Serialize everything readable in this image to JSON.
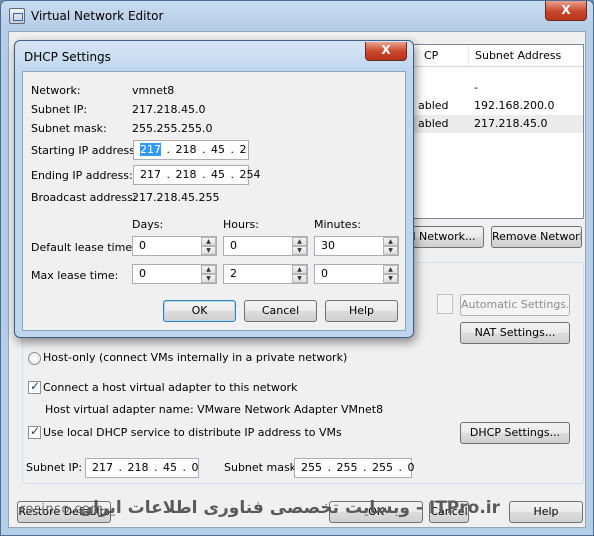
{
  "main": {
    "title": "Virtual Network Editor",
    "close_glyph": "X",
    "table": {
      "col_dhcp": "CP",
      "col_subnet": "Subnet Address",
      "rows": [
        {
          "dhcp": "",
          "subnet": "-"
        },
        {
          "dhcp": "abled",
          "subnet": "192.168.200.0"
        },
        {
          "dhcp": "abled",
          "subnet": "217.218.45.0"
        }
      ]
    },
    "add_network_label": "l Network...",
    "remove_network_label": "Remove Network",
    "automatic_settings_label": "Automatic Settings...",
    "nat_settings_label": "NAT Settings...",
    "host_only_label": "Host-only (connect VMs internally in a private network)",
    "connect_adapter_label": "Connect a host virtual adapter to this network",
    "adapter_name_text": "Host virtual adapter name: VMware Network Adapter VMnet8",
    "use_dhcp_label": "Use local DHCP service to distribute IP address to VMs",
    "dhcp_settings_label": "DHCP Settings...",
    "subnet_ip_label": "Subnet IP:",
    "subnet_ip_value": "217 . 218 . 45 . 0",
    "subnet_mask_label": "Subnet mask:",
    "subnet_mask_value": "255 . 255 . 255 . 0",
    "restore_defaults_label": "Restore Defaults",
    "cancel_label": "Cancel",
    "help_label": "Help",
    "ok_label": "OK"
  },
  "watermark": {
    "left": "rosinso.com",
    "right": "ITPro.ir - وبسایت تخصصی فناوری اطلاعات ایران"
  },
  "dhcp": {
    "title": "DHCP Settings",
    "close_glyph": "X",
    "network_label": "Network:",
    "network_value": "vmnet8",
    "subnet_ip_label": "Subnet IP:",
    "subnet_ip_value": "217.218.45.0",
    "subnet_mask_label": "Subnet mask:",
    "subnet_mask_value": "255.255.255.0",
    "start_ip_label": "Starting IP address:",
    "start_ip_first": "217",
    "start_ip_rest": " . 218 . 45 . 2",
    "end_ip_label": "Ending IP address:",
    "end_ip_value": "217 . 218 . 45 . 254",
    "broadcast_label": "Broadcast address:",
    "broadcast_value": "217.218.45.255",
    "days_label": "Days:",
    "hours_label": "Hours:",
    "minutes_label": "Minutes:",
    "default_lease_label": "Default lease time:",
    "max_lease_label": "Max lease time:",
    "default_days": "0",
    "default_hours": "0",
    "default_minutes": "30",
    "max_days": "0",
    "max_hours": "2",
    "max_minutes": "0",
    "ok_label": "OK",
    "cancel_label": "Cancel",
    "help_label": "Help",
    "spin_up": "▲",
    "spin_down": "▼"
  }
}
